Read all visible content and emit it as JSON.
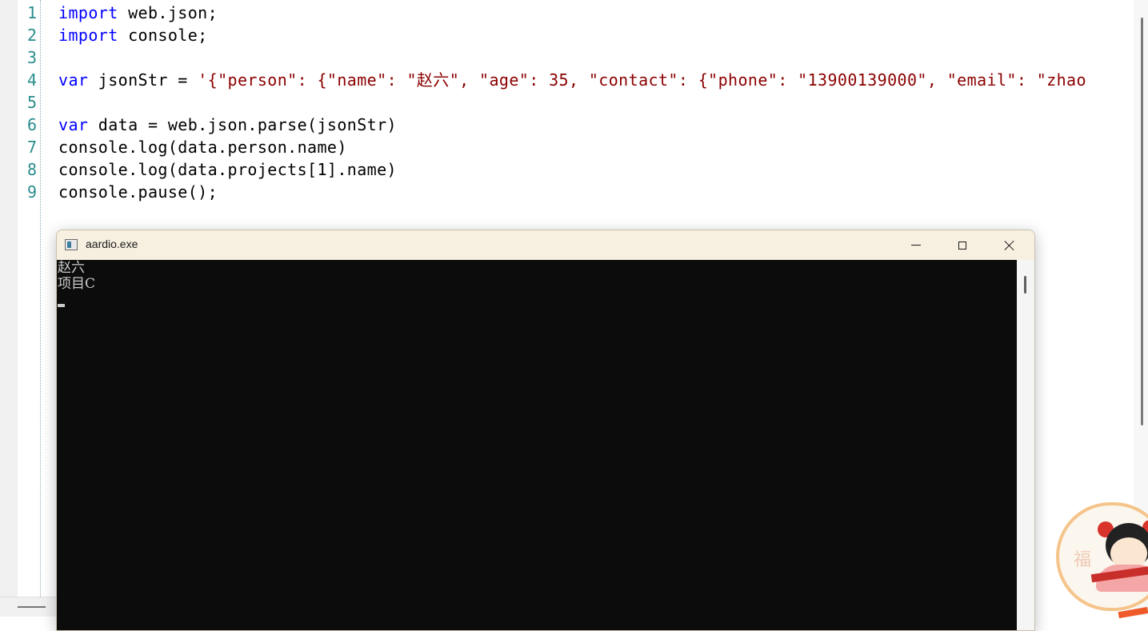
{
  "editor": {
    "line_numbers": [
      "1",
      "2",
      "3",
      "4",
      "5",
      "6",
      "7",
      "8",
      "9"
    ],
    "lines": [
      [
        {
          "t": "import",
          "c": "kw"
        },
        {
          "t": " web.json;",
          "c": ""
        }
      ],
      [
        {
          "t": "import",
          "c": "kw"
        },
        {
          "t": " console;",
          "c": ""
        }
      ],
      [],
      [
        {
          "t": "var",
          "c": "kw"
        },
        {
          "t": " jsonStr = ",
          "c": ""
        },
        {
          "t": "'{\"person\": {\"name\": \"赵六\", \"age\": 35, \"contact\": {\"phone\": \"13900139000\", \"email\": \"zhao",
          "c": "str"
        }
      ],
      [],
      [
        {
          "t": "var",
          "c": "kw"
        },
        {
          "t": " data = web.json.parse(jsonStr)",
          "c": ""
        }
      ],
      [
        {
          "t": "console.log(data.person.name)",
          "c": ""
        }
      ],
      [
        {
          "t": "console.log(data.projects[1].name)",
          "c": ""
        }
      ],
      [
        {
          "t": "console.pause();",
          "c": ""
        }
      ]
    ]
  },
  "console_window": {
    "title": "aardio.exe",
    "output_lines": [
      "赵六",
      "项目C"
    ]
  },
  "mascot": {
    "fu_char": "福"
  },
  "colors": {
    "keyword": "#0000ff",
    "string": "#8b0000",
    "line_number": "#2a8c8c",
    "console_bg": "#0c0c0c",
    "console_text": "#cccccc"
  }
}
